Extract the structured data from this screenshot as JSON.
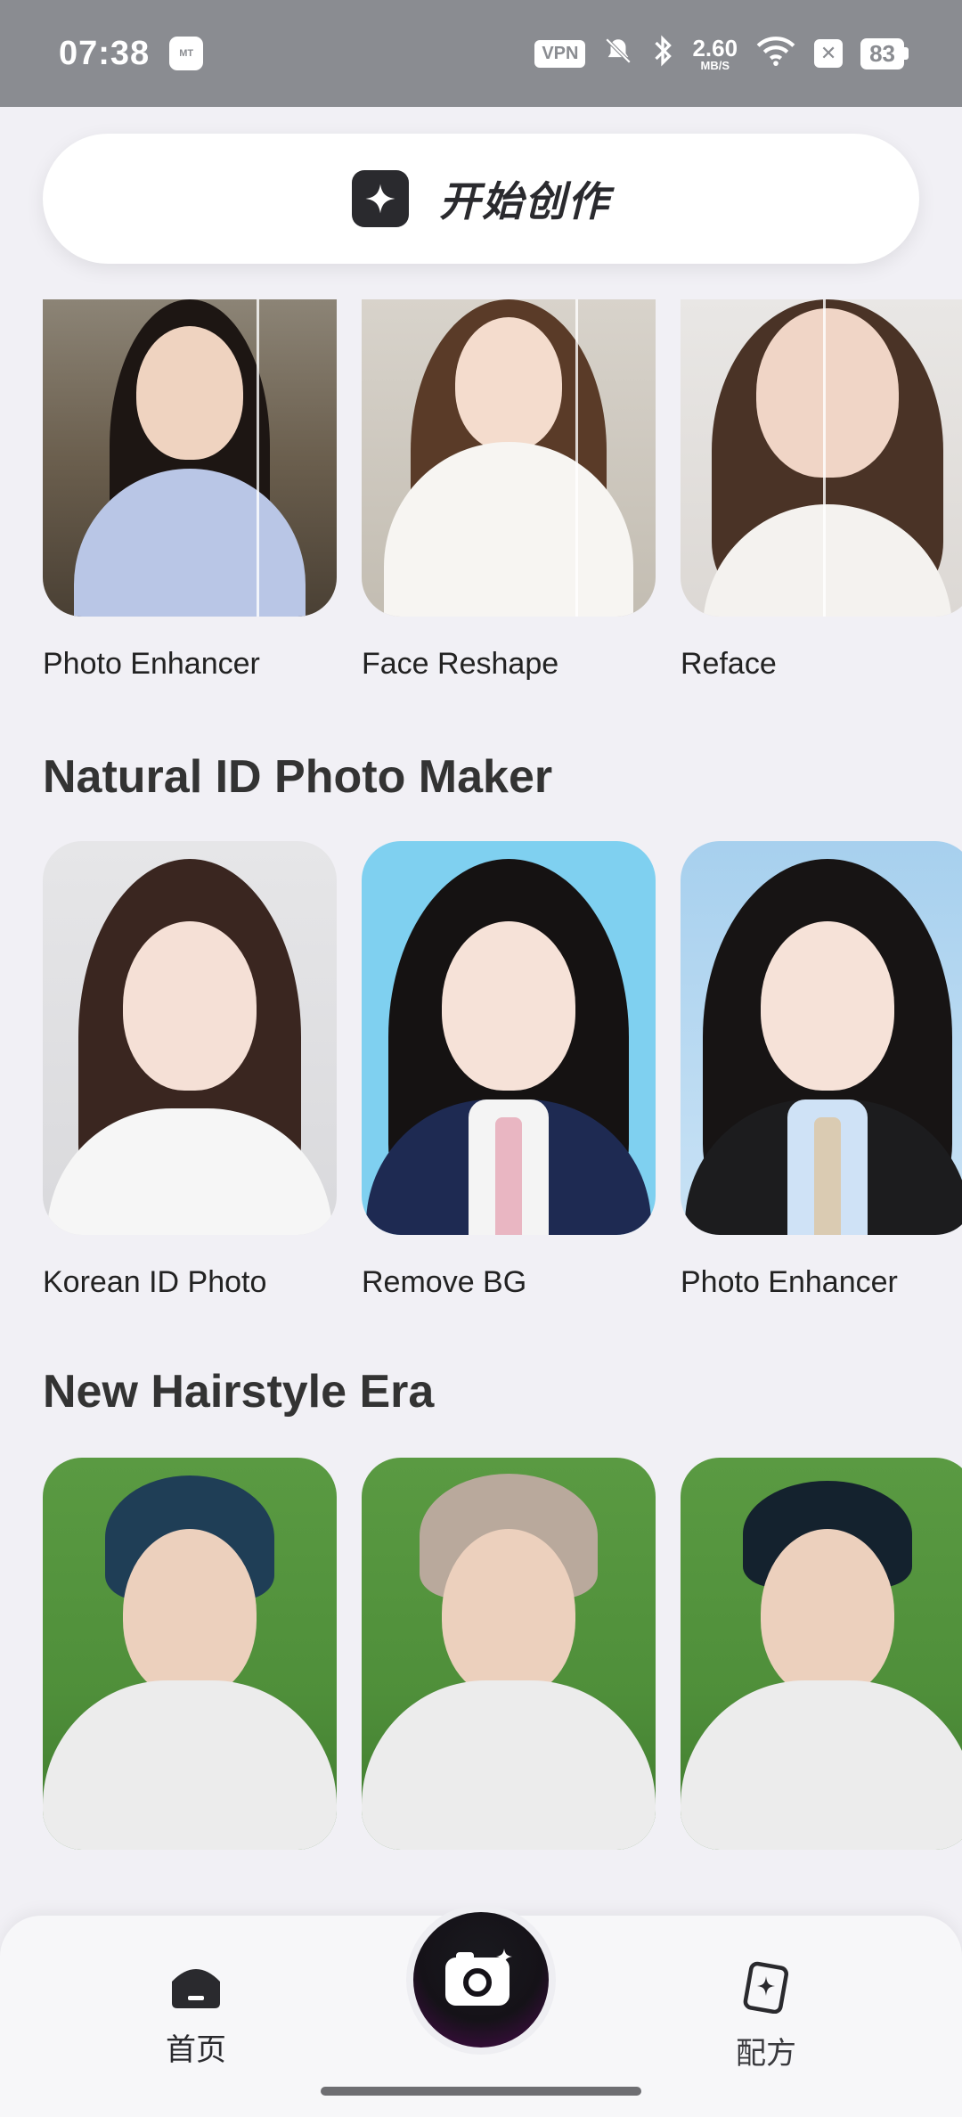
{
  "status_bar": {
    "time": "07:38",
    "vpn": "VPN",
    "speed_value": "2.60",
    "speed_unit": "MB/S",
    "battery": "83"
  },
  "create_button": {
    "label": "开始创作",
    "icon": "sparkle-icon"
  },
  "sections": [
    {
      "title": "",
      "items": [
        {
          "label": "Photo Enhancer"
        },
        {
          "label": "Face Reshape"
        },
        {
          "label": "Reface"
        }
      ]
    },
    {
      "title": "Natural ID Photo Maker",
      "items": [
        {
          "label": "Korean ID Photo"
        },
        {
          "label": "Remove BG"
        },
        {
          "label": "Photo Enhancer"
        }
      ]
    },
    {
      "title": "New Hairstyle Era",
      "items": [
        {
          "label": ""
        },
        {
          "label": ""
        },
        {
          "label": ""
        }
      ]
    }
  ],
  "bottom_nav": {
    "home_label": "首页",
    "recipes_label": "配方",
    "camera_icon": "camera-icon"
  },
  "colors": {
    "background": "#f1f0f5",
    "status_bar": "#8a8c91",
    "id_blue_bg": "#7fd0f0",
    "grass": "#4f8f3a"
  }
}
